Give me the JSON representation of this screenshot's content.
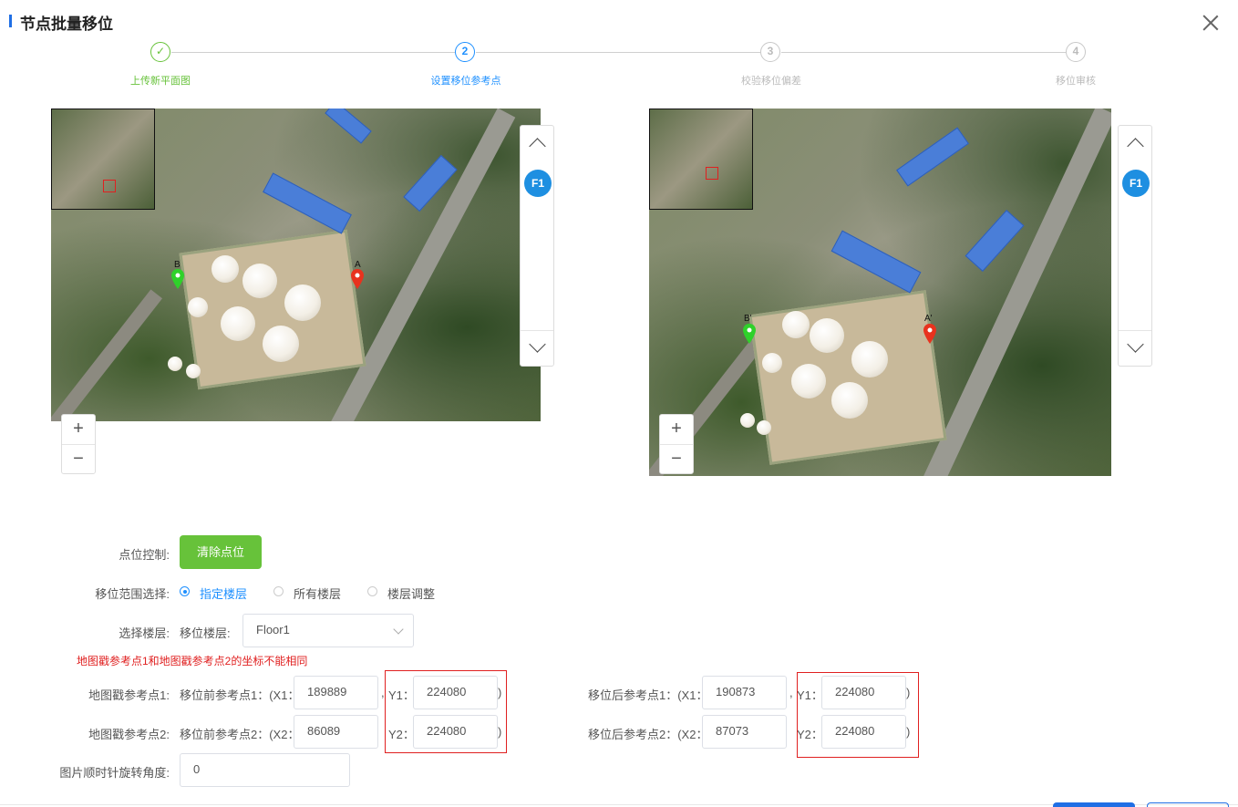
{
  "dialog": {
    "title": "节点批量移位"
  },
  "steps": [
    {
      "num": "✓",
      "label": "上传新平面图",
      "state": "done"
    },
    {
      "num": "2",
      "label": "设置移位参考点",
      "state": "active"
    },
    {
      "num": "3",
      "label": "校验移位偏差",
      "state": "todo"
    },
    {
      "num": "4",
      "label": "移位审核",
      "state": "todo"
    }
  ],
  "map_left": {
    "marker_a": "A",
    "marker_b": "B",
    "floor_badge": "F1",
    "zoom_in": "+",
    "zoom_out": "−"
  },
  "map_right": {
    "marker_a": "A'",
    "marker_b": "B'",
    "floor_badge": "F1",
    "zoom_in": "+",
    "zoom_out": "−"
  },
  "colors": {
    "accent": "#1e90ff",
    "success": "#67c23a",
    "error": "#e02020",
    "marker_a": "#e8321e",
    "marker_b": "#2fd12a"
  },
  "form": {
    "point_control_label": "点位控制:",
    "clear_button": "清除点位",
    "range_label": "移位范围选择:",
    "range_options": [
      "指定楼层",
      "所有楼层",
      "楼层调整"
    ],
    "range_selected": "指定楼层",
    "floor_label": "选择楼层:",
    "floor_sublabel": "移位楼层:",
    "floor_value": "Floor1",
    "error_message": "地图戳参考点1和地图戳参考点2的坐标不能相同",
    "ref1_label": "地图戳参考点1:",
    "ref2_label": "地图戳参考点2:",
    "before1_prefix": "移位前参考点1：(X1：",
    "before2_prefix": "移位前参考点2：(X2：",
    "after1_prefix": "移位后参考点1：(X1：",
    "after2_prefix": "移位后参考点2：(X2：",
    "y1_label": "Y1：",
    "y2_label": "Y2：",
    "comma": ",",
    "close_paren": ")",
    "before1_x": "189889",
    "before1_y": "224080",
    "before2_x": "86089",
    "before2_y": "224080",
    "after1_x": "190873",
    "after1_y": "224080",
    "after2_x": "87073",
    "after2_y": "224080",
    "rotation_label": "图片顺时针旋转角度:",
    "rotation_value": "0"
  }
}
